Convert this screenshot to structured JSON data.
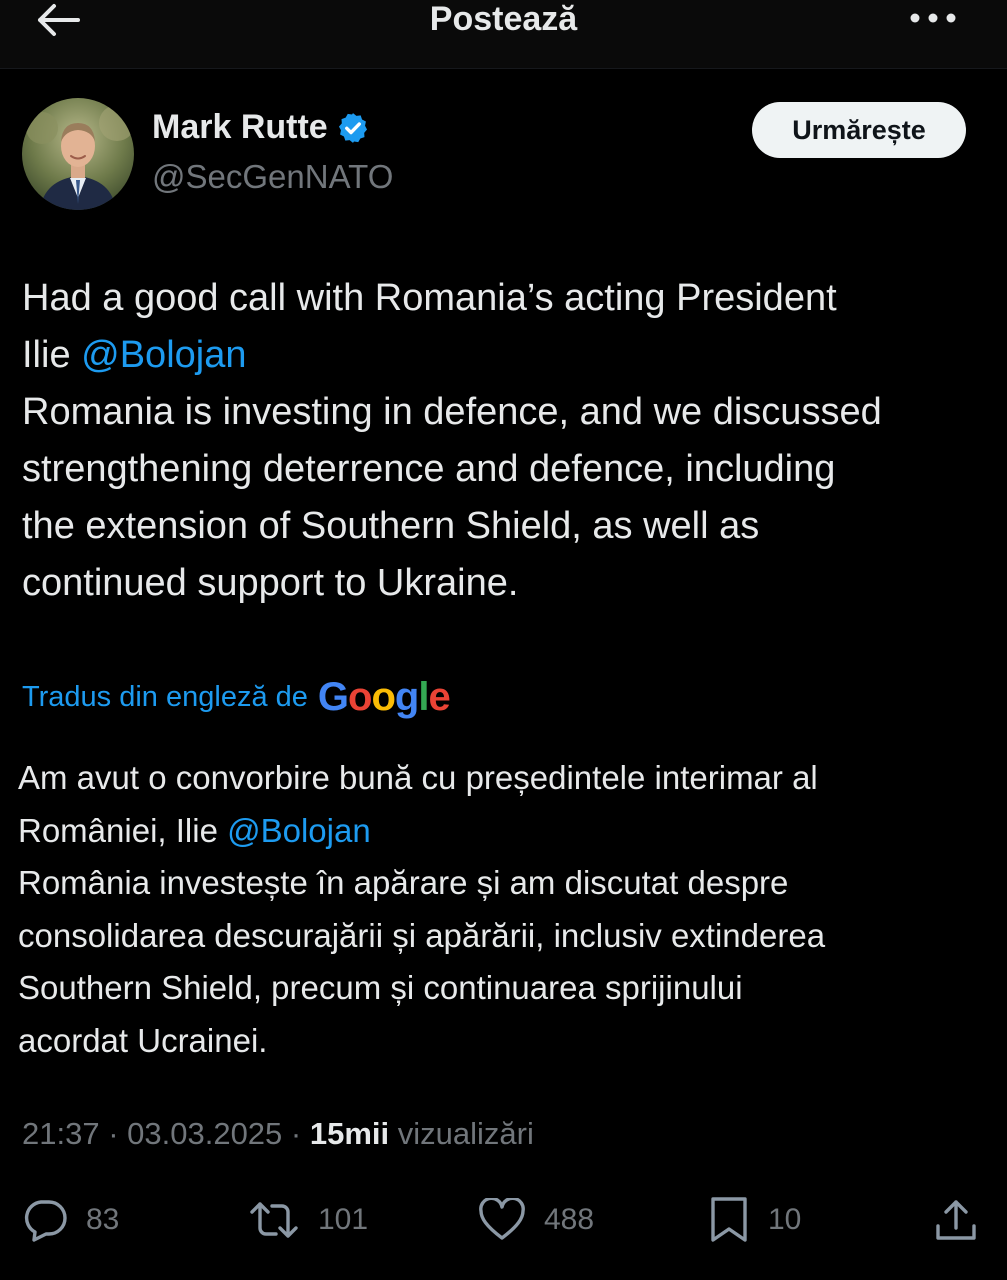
{
  "header": {
    "title": "Postează"
  },
  "author": {
    "name": "Mark Rutte",
    "handle": "@SecGenNATO",
    "follow_label": "Urmărește",
    "verified_color": "#1d9bf0"
  },
  "tweet": {
    "line1": "Had a good call with Romania’s acting President",
    "line2_prefix": "Ilie ",
    "mention": "@Bolojan",
    "line3": "Romania is investing in defence, and we discussed",
    "line4": "strengthening deterrence and defence, including",
    "line5": "the extension of Southern Shield, as well as",
    "line6": "continued support to Ukraine."
  },
  "translation": {
    "label": "Tradus din engleză de",
    "provider": "Google",
    "line1": "Am avut o convorbire bună cu președintele interimar al",
    "line2_prefix": "României, Ilie ",
    "mention": "@Bolojan",
    "line3": "România investește în apărare și am discutat despre",
    "line4": "consolidarea descurajării și apărării, inclusiv extinderea",
    "line5": "Southern Shield, precum și continuarea sprijinului",
    "line6": "acordat Ucrainei."
  },
  "meta": {
    "time": "21:37",
    "date": "03.03.2025",
    "views_count": "15mii",
    "views_label": "vizualizări"
  },
  "actions": {
    "replies": "83",
    "reposts": "101",
    "likes": "488",
    "bookmarks": "10"
  },
  "colors": {
    "background": "#000000",
    "text": "#e7e9ea",
    "muted": "#71767b",
    "accent": "#1d9bf0"
  },
  "icons": [
    "back-arrow-icon",
    "more-icon",
    "verified-badge-icon",
    "reply-icon",
    "repost-icon",
    "like-icon",
    "bookmark-icon",
    "share-icon"
  ]
}
